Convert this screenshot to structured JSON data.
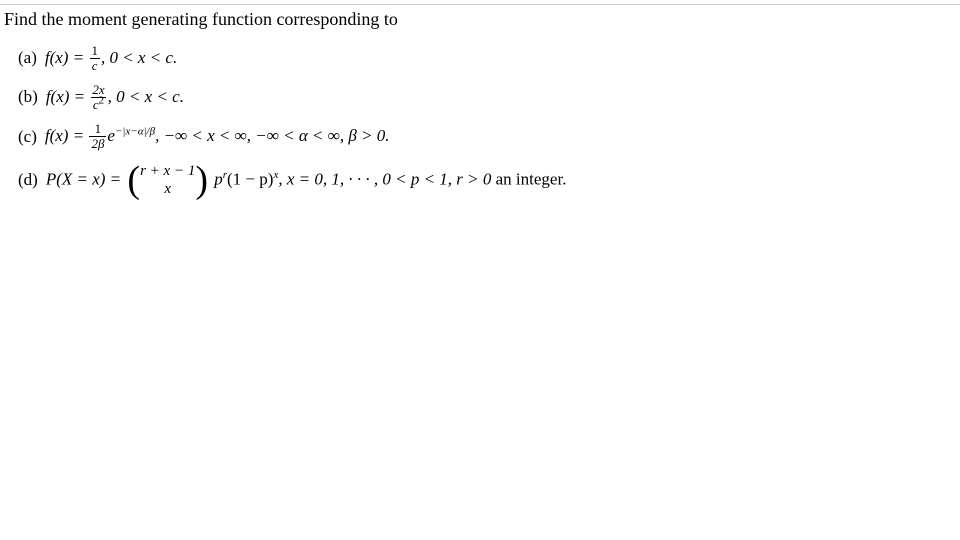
{
  "header": "Find the moment generating function corresponding to",
  "items": {
    "a": {
      "label": "(a)",
      "lhs": "f(x) = ",
      "frac_num": "1",
      "frac_den": "c",
      "cond": ", 0 < x < c."
    },
    "b": {
      "label": "(b)",
      "lhs": "f(x) = ",
      "frac_num": "2x",
      "frac_den_base": "c",
      "frac_den_sup": "2",
      "cond": ", 0 < x < c."
    },
    "c": {
      "label": "(c)",
      "lhs": "f(x) = ",
      "frac_num": "1",
      "frac_den": "2β",
      "e": "e",
      "exp": "−|x−α|/β",
      "cond": ", −∞ < x < ∞, −∞ < α < ∞, β > 0."
    },
    "d": {
      "label": "(d)",
      "lhs": "P(X = x) = ",
      "binom_top": "r + x − 1",
      "binom_bot": "x",
      "p": "p",
      "r": "r",
      "one_minus_p": "(1 − p)",
      "x": "x",
      "cond1": ", x = 0, 1, · · · , 0 < p < 1, r > 0 ",
      "cond2": "an integer."
    }
  }
}
